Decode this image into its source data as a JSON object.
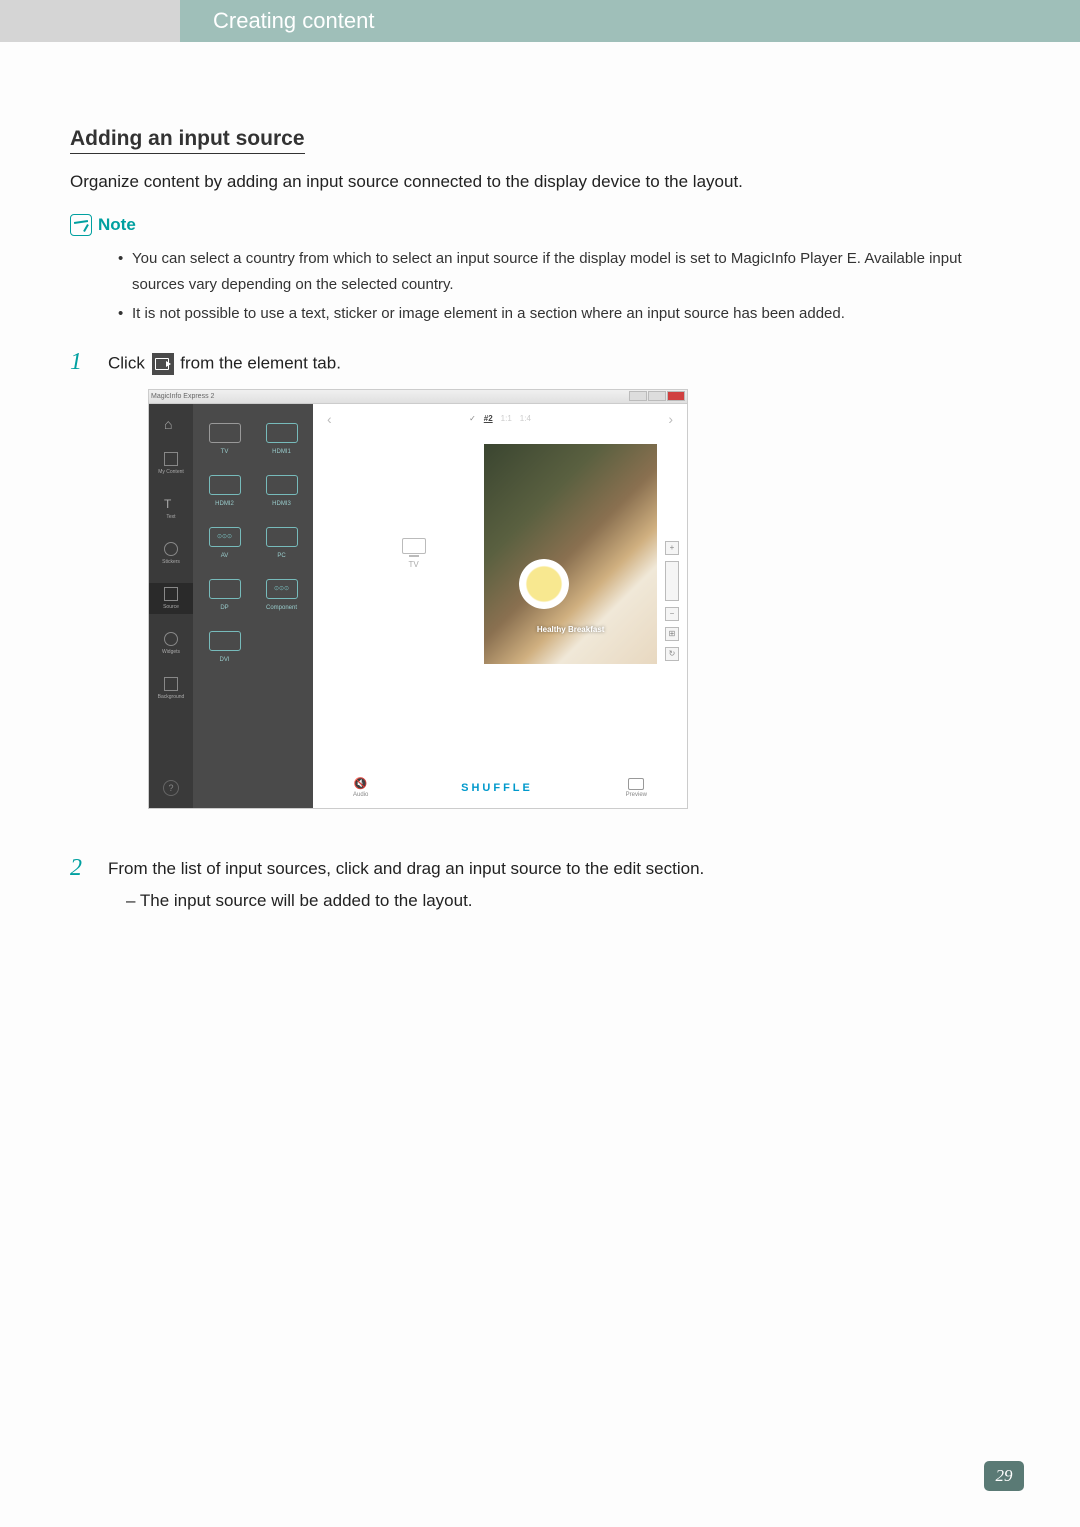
{
  "header": {
    "title": "Creating content"
  },
  "section": {
    "title": "Adding an input source",
    "intro": "Organize content by adding an input source connected to the display device to the layout."
  },
  "note": {
    "label": "Note",
    "items": [
      "You can select a country from which to select an input source if the display model is set to MagicInfo Player E. Available input sources vary depending on the selected country.",
      "It is not possible to use a text, sticker or image element in a section where an input source has been added."
    ]
  },
  "steps": {
    "one": {
      "num": "1",
      "pre": "Click ",
      "post": " from the element tab."
    },
    "two": {
      "num": "2",
      "text": "From the list of input sources, click and drag an input source to the edit section.",
      "sub": "– The input source will be added to the layout."
    }
  },
  "screenshot": {
    "title": "MagicInfo Express 2",
    "sidebar": {
      "mycontent": "My Content",
      "text": "Text",
      "stickers": "Stickers",
      "source": "Source",
      "widgets": "Widgets",
      "background": "Background"
    },
    "sources": {
      "tv": "TV",
      "hdmi1": "HDMI1",
      "hdmi2": "HDMI2",
      "hdmi3": "HDMI3",
      "av": "AV",
      "pc": "PC",
      "dp": "DP",
      "component": "Component",
      "dvi": "DVI"
    },
    "topbar": {
      "ratio1": "#2",
      "ratio2": "1:1",
      "ratio3": "1:4"
    },
    "canvas": {
      "tv_label": "TV",
      "food_label": "Healthy Breakfast"
    },
    "bottom": {
      "audio": "Audio",
      "shuffle": "SHUFFLE",
      "preview": "Preview"
    }
  },
  "page_number": "29"
}
